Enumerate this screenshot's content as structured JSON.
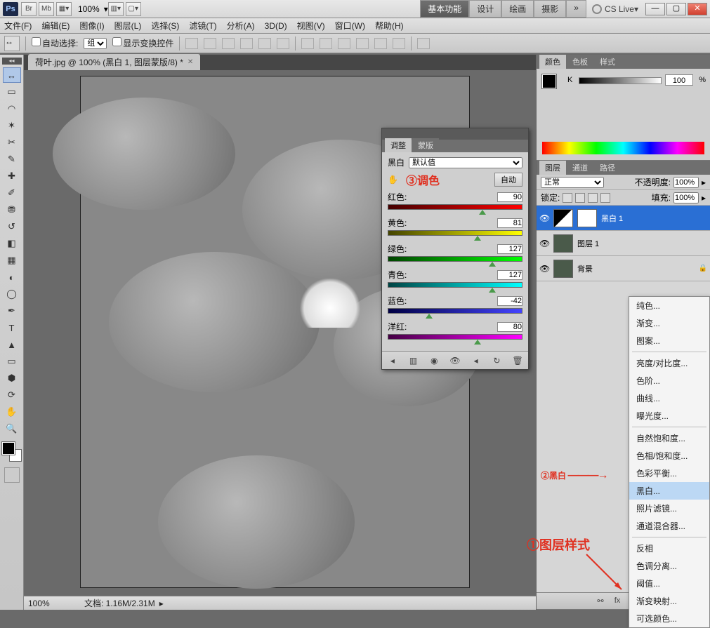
{
  "titlebar": {
    "ps": "Ps",
    "br": "Br",
    "mb": "Mb",
    "zoom": "100%",
    "workspaces": [
      "基本功能",
      "设计",
      "绘画",
      "摄影"
    ],
    "cslive": "CS Live",
    "chevrons": "»"
  },
  "menu": [
    "文件(F)",
    "编辑(E)",
    "图像(I)",
    "图层(L)",
    "选择(S)",
    "滤镜(T)",
    "分析(A)",
    "3D(D)",
    "视图(V)",
    "窗口(W)",
    "帮助(H)"
  ],
  "options": {
    "auto_select_label": "自动选择:",
    "group_option": "组",
    "show_transform": "显示变换控件"
  },
  "doc_tab": "荷叶.jpg @ 100% (黑白 1, 图层蒙版/8) *",
  "status": {
    "zoom": "100%",
    "info": "文档: 1.16M/2.31M"
  },
  "color_panel": {
    "tabs": [
      "颜色",
      "色板",
      "样式"
    ],
    "channel": "K",
    "value": "100",
    "pct": "%"
  },
  "layers_panel": {
    "tabs": [
      "图层",
      "通道",
      "路径"
    ],
    "blend_mode": "正常",
    "opacity_label": "不透明度:",
    "opacity_value": "100%",
    "lock_label": "锁定:",
    "fill_label": "填充:",
    "fill_value": "100%",
    "layers": [
      {
        "name": "黑白 1",
        "kind": "adj",
        "selected": true
      },
      {
        "name": "图层 1",
        "kind": "img"
      },
      {
        "name": "背景",
        "kind": "img",
        "locked": true
      }
    ]
  },
  "adjustments": {
    "tabs": [
      "调整",
      "蒙版"
    ],
    "type_label": "黑白",
    "preset": "默认值",
    "tint_label": "③调色",
    "auto_label": "自动",
    "sliders": [
      {
        "label": "红色:",
        "value": "90",
        "gradient": "linear-gradient(to right,#400,#f00)",
        "pos": 68
      },
      {
        "label": "黄色:",
        "value": "81",
        "gradient": "linear-gradient(to right,#440,#ff0)",
        "pos": 64
      },
      {
        "label": "绿色:",
        "value": "127",
        "gradient": "linear-gradient(to right,#040,#0f0)",
        "pos": 75
      },
      {
        "label": "青色:",
        "value": "127",
        "gradient": "linear-gradient(to right,#044,#0ff)",
        "pos": 75
      },
      {
        "label": "蓝色:",
        "value": "-42",
        "gradient": "linear-gradient(to right,#004,#44f)",
        "pos": 28
      },
      {
        "label": "洋红:",
        "value": "80",
        "gradient": "linear-gradient(to right,#404,#f0f)",
        "pos": 64
      }
    ]
  },
  "ctx_menu": {
    "groups": [
      [
        "纯色...",
        "渐变...",
        "图案..."
      ],
      [
        "亮度/对比度...",
        "色阶...",
        "曲线...",
        "曝光度..."
      ],
      [
        "自然饱和度...",
        "色相/饱和度...",
        "色彩平衡...",
        "黑白...",
        "照片滤镜...",
        "通道混合器..."
      ],
      [
        "反相",
        "色调分离...",
        "阈值...",
        "渐变映射...",
        "可选颜色..."
      ]
    ],
    "highlight": "黑白..."
  },
  "annotations": {
    "a1": "①图层样式",
    "a2": "②黑白",
    "a3": "③调色"
  }
}
